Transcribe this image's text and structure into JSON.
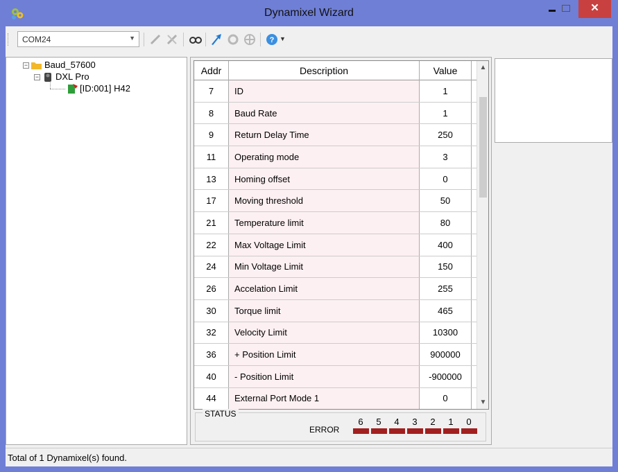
{
  "window": {
    "title": "Dynamixel Wizard",
    "close_glyph": "✕"
  },
  "toolbar": {
    "port": "COM24",
    "icons": [
      "connect-icon",
      "disconnect-icon",
      "search-icon",
      "firmware-update-icon",
      "refresh-icon",
      "settings-icon",
      "help-icon"
    ]
  },
  "tree": {
    "root_label": "Baud_57600",
    "model_label": "DXL Pro",
    "device_label": "[ID:001] H42"
  },
  "grid": {
    "headers": {
      "addr": "Addr",
      "description": "Description",
      "value": "Value"
    },
    "rows": [
      {
        "addr": "7",
        "description": "ID",
        "value": "1"
      },
      {
        "addr": "8",
        "description": "Baud Rate",
        "value": "1"
      },
      {
        "addr": "9",
        "description": "Return Delay Time",
        "value": "250"
      },
      {
        "addr": "11",
        "description": "Operating mode",
        "value": "3"
      },
      {
        "addr": "13",
        "description": "Homing offset",
        "value": "0"
      },
      {
        "addr": "17",
        "description": "Moving threshold",
        "value": "50"
      },
      {
        "addr": "21",
        "description": "Temperature limit",
        "value": "80"
      },
      {
        "addr": "22",
        "description": "Max Voltage Limit",
        "value": "400"
      },
      {
        "addr": "24",
        "description": "Min Voltage Limit",
        "value": "150"
      },
      {
        "addr": "26",
        "description": "Accelation Limit",
        "value": "255"
      },
      {
        "addr": "30",
        "description": "Torque limit",
        "value": "465"
      },
      {
        "addr": "32",
        "description": "Velocity Limit",
        "value": "10300"
      },
      {
        "addr": "36",
        "description": "+ Position Limit",
        "value": "900000"
      },
      {
        "addr": "40",
        "description": "- Position Limit",
        "value": "-900000"
      },
      {
        "addr": "44",
        "description": "External Port Mode 1",
        "value": "0"
      }
    ]
  },
  "status": {
    "group_label": "STATUS",
    "error_label": "ERROR",
    "bits": [
      "6",
      "5",
      "4",
      "3",
      "2",
      "1",
      "0"
    ],
    "led_color": "#a21f1f"
  },
  "statusbar": {
    "text": "Total of 1 Dynamixel(s) found."
  }
}
